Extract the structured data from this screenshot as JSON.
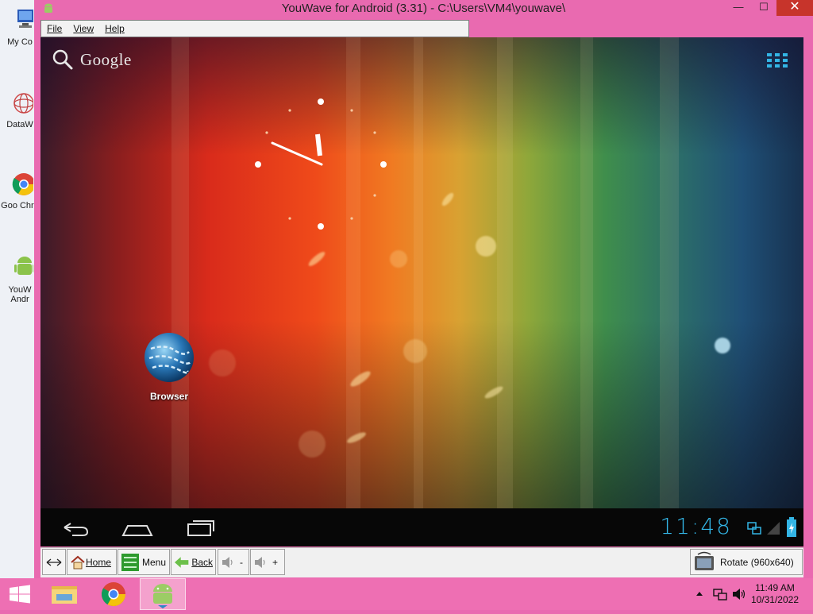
{
  "window": {
    "title": "YouWave for Android (3.31) - C:\\Users\\VM4\\youwave\\",
    "minimize_glyph": "—",
    "maximize_glyph": "☐",
    "close_glyph": "✕"
  },
  "menu": {
    "file": "File",
    "view": "View",
    "help": "Help"
  },
  "desktop_icons": [
    {
      "label": "My Co",
      "icon": "computer-icon"
    },
    {
      "label": "DataW",
      "icon": "datawave-icon"
    },
    {
      "label": "Goo Chro",
      "icon": "chrome-icon"
    },
    {
      "label": "YouW Andr",
      "icon": "android-icon"
    }
  ],
  "android": {
    "search_label": "Google",
    "browser_label": "Browser",
    "time": "11:48"
  },
  "toolbar": {
    "home": "Home",
    "menu": "Menu",
    "back": "Back",
    "vol_down": "-",
    "vol_up": "+",
    "rotate": "Rotate (960x640)"
  },
  "taskbar": {
    "time": "11:49 AM",
    "date": "10/31/2022"
  },
  "colors": {
    "window_frame": "#e96ab0",
    "taskbar": "#ee6fb3",
    "clock_blue": "#33b5e5",
    "close_red": "#c7342b"
  }
}
